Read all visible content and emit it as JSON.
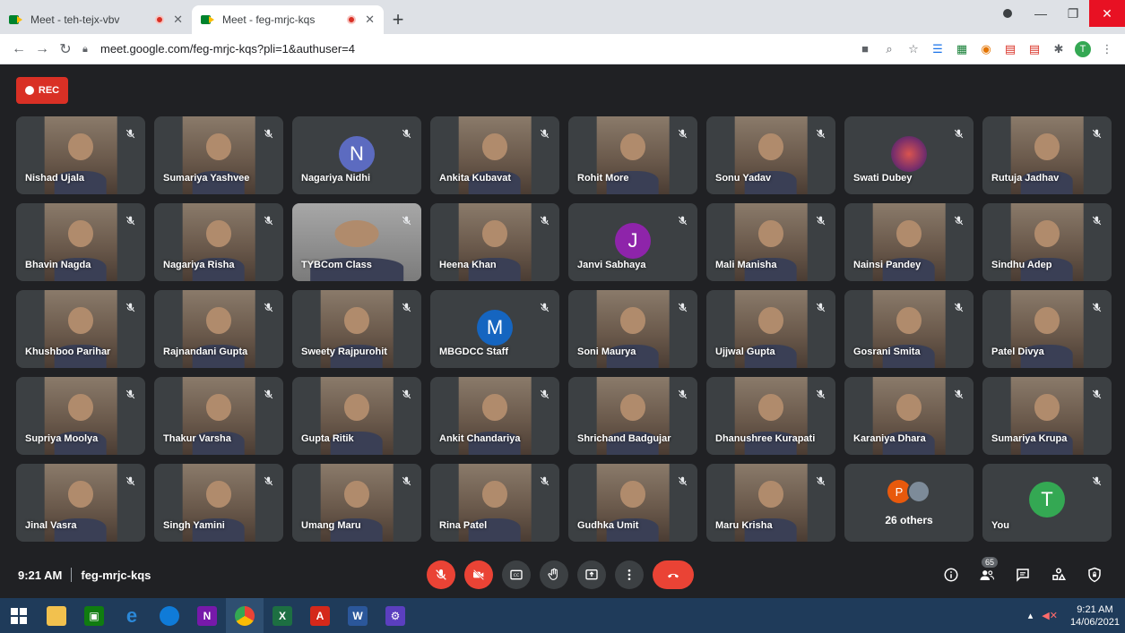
{
  "browser": {
    "tabs": [
      {
        "title": "Meet - teh-tejx-vbv",
        "active": false
      },
      {
        "title": "Meet - feg-mrjc-kqs",
        "active": true
      }
    ],
    "new_tab": "+",
    "url": "meet.google.com/feg-mrjc-kqs?pli=1&authuser=4",
    "profile_initial": "T"
  },
  "meet": {
    "rec_label": "REC",
    "participants": [
      {
        "name": "Nishad Ujala",
        "type": "video"
      },
      {
        "name": "Sumariya Yashvee",
        "type": "video"
      },
      {
        "name": "Nagariya Nidhi",
        "type": "letter",
        "letter": "N",
        "color": "#5c6bc0"
      },
      {
        "name": "Ankita Kubavat",
        "type": "video"
      },
      {
        "name": "Rohit More",
        "type": "video"
      },
      {
        "name": "Sonu Yadav",
        "type": "video"
      },
      {
        "name": "Swati Dubey",
        "type": "avatar"
      },
      {
        "name": "Rutuja Jadhav",
        "type": "video"
      },
      {
        "name": "Bhavin Nagda",
        "type": "video"
      },
      {
        "name": "Nagariya Risha",
        "type": "video"
      },
      {
        "name": "TYBCom Class",
        "type": "wide"
      },
      {
        "name": "Heena Khan",
        "type": "video"
      },
      {
        "name": "Janvi Sabhaya",
        "type": "letter",
        "letter": "J",
        "color": "#8e24aa"
      },
      {
        "name": "Mali Manisha",
        "type": "video"
      },
      {
        "name": "Nainsi Pandey",
        "type": "video"
      },
      {
        "name": "Sindhu Adep",
        "type": "video"
      },
      {
        "name": "Khushboo Parihar",
        "type": "video"
      },
      {
        "name": "Rajnandani Gupta",
        "type": "video"
      },
      {
        "name": "Sweety Rajpurohit",
        "type": "video"
      },
      {
        "name": "MBGDCC Staff",
        "type": "letter",
        "letter": "M",
        "color": "#1565c0"
      },
      {
        "name": "Soni Maurya",
        "type": "video"
      },
      {
        "name": "Ujjwal Gupta",
        "type": "video"
      },
      {
        "name": "Gosrani Smita",
        "type": "video"
      },
      {
        "name": "Patel Divya",
        "type": "video"
      },
      {
        "name": "Supriya Moolya",
        "type": "video"
      },
      {
        "name": "Thakur Varsha",
        "type": "video"
      },
      {
        "name": "Gupta Ritik",
        "type": "video"
      },
      {
        "name": "Ankit Chandariya",
        "type": "video"
      },
      {
        "name": "Shrichand Badgujar",
        "type": "video"
      },
      {
        "name": "Dhanushree Kurapati",
        "type": "video"
      },
      {
        "name": "Karaniya Dhara",
        "type": "video"
      },
      {
        "name": "Sumariya Krupa",
        "type": "video"
      },
      {
        "name": "Jinal Vasra",
        "type": "video"
      },
      {
        "name": "Singh Yamini",
        "type": "video"
      },
      {
        "name": "Umang Maru",
        "type": "video"
      },
      {
        "name": "Rina Patel",
        "type": "video"
      },
      {
        "name": "Gudhka Umit",
        "type": "video"
      },
      {
        "name": "Maru Krisha",
        "type": "video"
      }
    ],
    "others": {
      "initial": "P",
      "label": "26 others"
    },
    "self": {
      "letter": "T",
      "label": "You",
      "color": "#34a853"
    },
    "time": "9:21 AM",
    "meeting_code": "feg-mrjc-kqs",
    "people_count": "65"
  },
  "taskbar": {
    "time": "9:21 AM",
    "date": "14/06/2021"
  }
}
